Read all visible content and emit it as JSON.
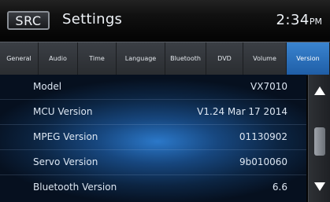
{
  "header": {
    "source_button": "SRC",
    "title": "Settings",
    "time": "2:34",
    "ampm": "PM"
  },
  "tabs": [
    {
      "label": "General",
      "active": false
    },
    {
      "label": "Audio",
      "active": false
    },
    {
      "label": "Time",
      "active": false
    },
    {
      "label": "Language",
      "active": false
    },
    {
      "label": "Bluetooth",
      "active": false
    },
    {
      "label": "DVD",
      "active": false
    },
    {
      "label": "Volume",
      "active": false
    },
    {
      "label": "Version",
      "active": true
    }
  ],
  "version_info": [
    {
      "label": "Model",
      "value": "VX7010"
    },
    {
      "label": "MCU Version",
      "value": "V1.24 Mar 17 2014"
    },
    {
      "label": "MPEG Version",
      "value": "01130902"
    },
    {
      "label": "Servo Version",
      "value": "9b010060"
    },
    {
      "label": "Bluetooth Version",
      "value": "6.6"
    }
  ],
  "scroll": {
    "up_icon": "triangle-up-icon",
    "down_icon": "triangle-down-icon"
  },
  "colors": {
    "accent": "#2a6fbf",
    "background": "#050505"
  }
}
